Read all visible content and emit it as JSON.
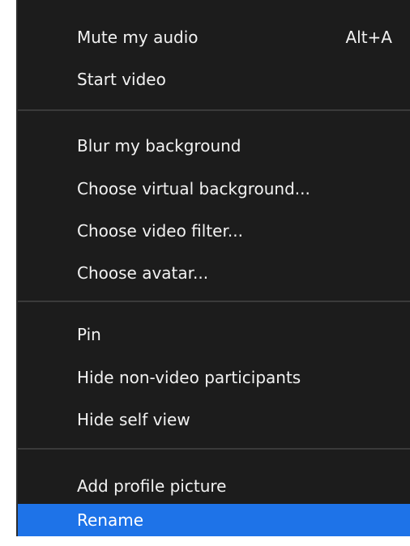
{
  "menu": {
    "groups": [
      {
        "items": [
          {
            "label": "Mute my audio",
            "shortcut": "Alt+A"
          },
          {
            "label": "Start video"
          }
        ]
      },
      {
        "items": [
          {
            "label": "Blur my background"
          },
          {
            "label": "Choose virtual background..."
          },
          {
            "label": "Choose video filter..."
          },
          {
            "label": "Choose avatar..."
          }
        ]
      },
      {
        "items": [
          {
            "label": "Pin"
          },
          {
            "label": "Hide non-video participants"
          },
          {
            "label": "Hide self view"
          }
        ]
      },
      {
        "items": [
          {
            "label": "Add profile picture"
          },
          {
            "label": "Rename",
            "selected": true
          }
        ]
      }
    ]
  },
  "colors": {
    "menu_background": "#1c1c1c",
    "selection_highlight": "#1e73e8",
    "text": "#f2f2f2",
    "separator": "#3a3a3a"
  }
}
